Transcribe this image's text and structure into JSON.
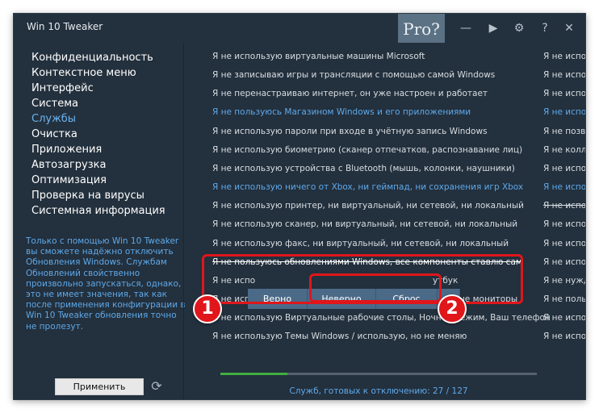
{
  "window": {
    "title": "Win 10 Tweaker",
    "pro_label": "Pro?"
  },
  "titlebar_icons": [
    "minimize-icon",
    "play-icon",
    "gear-icon",
    "help-icon",
    "close-icon"
  ],
  "sidebar": {
    "items": [
      {
        "label": "Конфиденциальность"
      },
      {
        "label": "Контекстное меню"
      },
      {
        "label": "Интерфейс"
      },
      {
        "label": "Система"
      },
      {
        "label": "Службы",
        "active": true
      },
      {
        "label": "Очистка"
      },
      {
        "label": "Приложения"
      },
      {
        "label": "Автозагрузка"
      },
      {
        "label": "Оптимизация"
      },
      {
        "label": "Проверка на вирусы"
      },
      {
        "label": "Системная информация"
      }
    ],
    "description": "Только с помощью Win 10 Tweaker вы сможете надёжно отключить Обновления Windows. Службам Обновлений свойственно произвольно запускаться, однако, это не имеет значения, так как после применения конфигурации в Win 10 Tweaker обновления точно не пролезут.",
    "apply_label": "Применить"
  },
  "services": {
    "rows": [
      {
        "text": "Я не использую виртуальные машины Microsoft",
        "right": "Я не испо"
      },
      {
        "text": "Я не записываю игры и трансляции с помощью самой Windows",
        "right": "Я не испо"
      },
      {
        "text": "Я не перенастраиваю интернет, он уже настроен и работает",
        "right": "Я не испо"
      },
      {
        "text": "Я не пользуюсь Магазином Windows и его приложениями",
        "right": "Я не испо",
        "style": "blue"
      },
      {
        "text": "Я не использую пароли при входе в учётную запись Windows",
        "right": "Я не позво"
      },
      {
        "text": "Я не использую биометрию (сканер отпечатков, распознавание лиц)",
        "right": "Я не колле"
      },
      {
        "text": "Я не использую устройства с Bluetooth (мышь, колонки, наушники)",
        "right": "Я не испо"
      },
      {
        "text": "Я не использую ничего от Xbox, ни геймпад, ни сохранения игр Xbox",
        "right": "Я не испо",
        "style": "blue"
      },
      {
        "text": "Я не использую принтер, ни виртуальный, ни сетевой, ни локальный",
        "right": "Я не испо",
        "right_style": "strike"
      },
      {
        "text": "Я не использую сканер, ни виртуальный, ни сетевой, ни локальный",
        "right": "Я не испо"
      },
      {
        "text": "Я не использую факс, ни виртуальный, ни сетевой, ни локальный",
        "right": "Я не испо"
      },
      {
        "text": "Я не пользуюсь обновлениями Windows, все компоненты ставлю сам",
        "right": "Я не испо",
        "style": "strike"
      },
      {
        "text": "Я не испо",
        "tail": "утбук",
        "right": "Я не нужда"
      },
      {
        "text": "Я не использую беспроводные, а также дополнительные мониторы",
        "right": "Я не польз"
      },
      {
        "text": "Я не использую Виртуальные рабочие столы, Ночной режим, Ваш телефон",
        "right": "Я не испо"
      },
      {
        "text": "Я не использую Темы Windows / использую, но не меняю",
        "right": "Я не испо"
      }
    ]
  },
  "context_menu": {
    "correct_label": "Верно",
    "wrong_label": "Неверно",
    "reset_label": "Сброс",
    "more_label": "≡"
  },
  "progress": {
    "fraction": 0.2126,
    "status_text": "Служб, готовых к отключению: 27 / 127"
  },
  "annotations": {
    "first": "1",
    "second": "2",
    "color": "#e0161b"
  }
}
